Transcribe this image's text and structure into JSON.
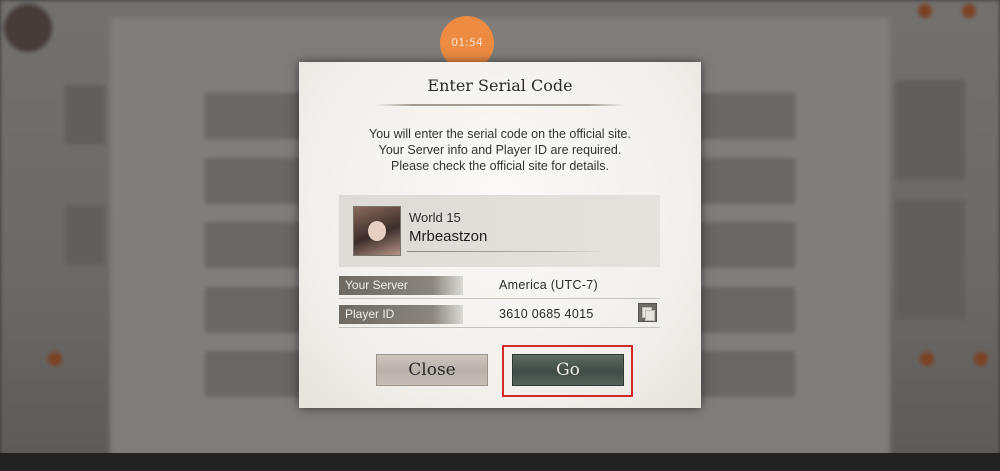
{
  "timer": {
    "text": "01:54"
  },
  "dialog": {
    "title": "Enter Serial Code",
    "message_lines": [
      "You will enter the serial code on the official site.",
      "Your Server info and Player ID are required.",
      "Please check the official site for details."
    ],
    "player": {
      "world": "World 15",
      "name": "Mrbeastzon"
    },
    "rows": [
      {
        "label": "Your Server",
        "value": "America (UTC-7)"
      },
      {
        "label": "Player ID",
        "value": "3610 0685 4015"
      }
    ],
    "buttons": {
      "close_label": "Close",
      "go_label": "Go"
    }
  },
  "colors": {
    "highlight": "#d02a2a",
    "timer": "#f58c3c",
    "go_button": "#46524c"
  }
}
